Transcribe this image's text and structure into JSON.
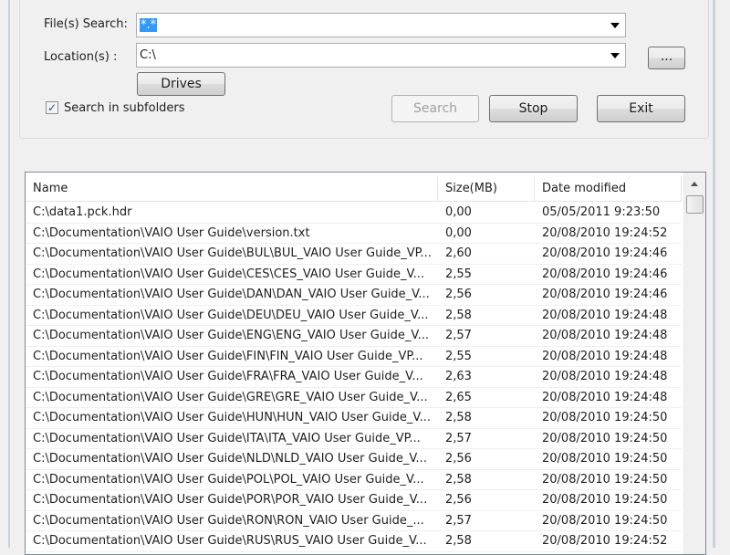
{
  "form": {
    "file_search_label": "File(s) Search:",
    "file_search_value": "*.*",
    "location_label": "Location(s) :",
    "location_value": "C:\\",
    "browse_label": "...",
    "drives_label": "Drives",
    "subfolders_label": "Search in subfolders",
    "subfolders_checked": true,
    "search_label": "Search",
    "stop_label": "Stop",
    "exit_label": "Exit"
  },
  "results": {
    "columns": [
      "Name",
      "Size(MB)",
      "Date modified"
    ],
    "rows": [
      [
        "C:\\data1.pck.hdr",
        "0,00",
        "05/05/2011 9:23:50"
      ],
      [
        "C:\\Documentation\\VAIO User Guide\\version.txt",
        "0,00",
        "20/08/2010 19:24:52"
      ],
      [
        "C:\\Documentation\\VAIO User Guide\\BUL\\BUL_VAIO User Guide_VP...",
        "2,60",
        "20/08/2010 19:24:46"
      ],
      [
        "C:\\Documentation\\VAIO User Guide\\CES\\CES_VAIO User Guide_V...",
        "2,55",
        "20/08/2010 19:24:46"
      ],
      [
        "C:\\Documentation\\VAIO User Guide\\DAN\\DAN_VAIO User Guide_V...",
        "2,56",
        "20/08/2010 19:24:46"
      ],
      [
        "C:\\Documentation\\VAIO User Guide\\DEU\\DEU_VAIO User Guide_V...",
        "2,58",
        "20/08/2010 19:24:48"
      ],
      [
        "C:\\Documentation\\VAIO User Guide\\ENG\\ENG_VAIO User Guide_V...",
        "2,57",
        "20/08/2010 19:24:48"
      ],
      [
        "C:\\Documentation\\VAIO User Guide\\FIN\\FIN_VAIO User Guide_VP...",
        "2,55",
        "20/08/2010 19:24:48"
      ],
      [
        "C:\\Documentation\\VAIO User Guide\\FRA\\FRA_VAIO User Guide_V...",
        "2,63",
        "20/08/2010 19:24:48"
      ],
      [
        "C:\\Documentation\\VAIO User Guide\\GRE\\GRE_VAIO User Guide_V...",
        "2,65",
        "20/08/2010 19:24:48"
      ],
      [
        "C:\\Documentation\\VAIO User Guide\\HUN\\HUN_VAIO User Guide_V...",
        "2,58",
        "20/08/2010 19:24:50"
      ],
      [
        "C:\\Documentation\\VAIO User Guide\\ITA\\ITA_VAIO User Guide_VP...",
        "2,57",
        "20/08/2010 19:24:50"
      ],
      [
        "C:\\Documentation\\VAIO User Guide\\NLD\\NLD_VAIO User Guide_V...",
        "2,56",
        "20/08/2010 19:24:50"
      ],
      [
        "C:\\Documentation\\VAIO User Guide\\POL\\POL_VAIO User Guide_V...",
        "2,58",
        "20/08/2010 19:24:50"
      ],
      [
        "C:\\Documentation\\VAIO User Guide\\POR\\POR_VAIO User Guide_V...",
        "2,56",
        "20/08/2010 19:24:50"
      ],
      [
        "C:\\Documentation\\VAIO User Guide\\RON\\RON_VAIO User Guide_...",
        "2,57",
        "20/08/2010 19:24:50"
      ],
      [
        "C:\\Documentation\\VAIO User Guide\\RUS\\RUS_VAIO User Guide_V...",
        "2,58",
        "20/08/2010 19:24:52"
      ]
    ]
  }
}
